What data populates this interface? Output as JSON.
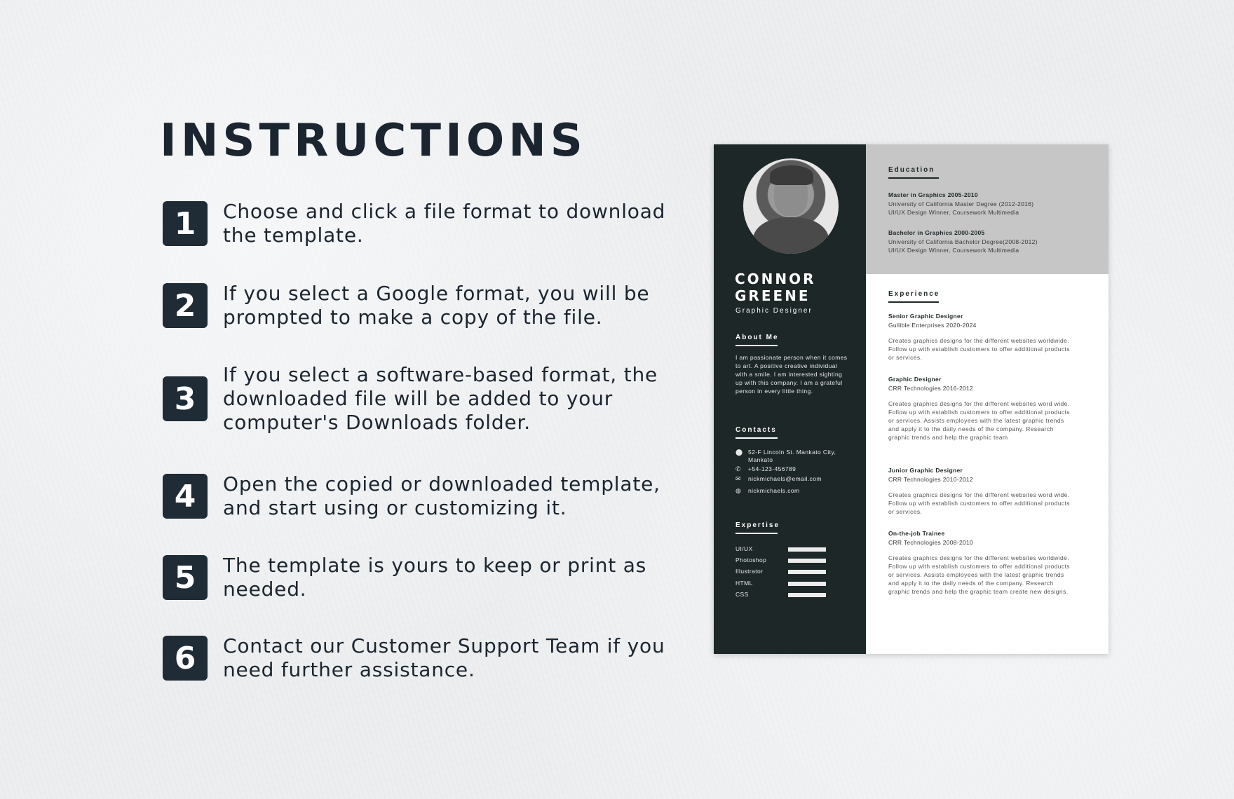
{
  "title": "INSTRUCTIONS",
  "steps": [
    {
      "num": "1",
      "text": "Choose and click a file format to download the template."
    },
    {
      "num": "2",
      "text": "If you select a Google format, you will be prompted to make a copy of the file."
    },
    {
      "num": "3",
      "text": "If you select a software-based format, the downloaded file will be added to your computer's Downloads folder."
    },
    {
      "num": "4",
      "text": "Open the copied or downloaded template, and start using or customizing it."
    },
    {
      "num": "5",
      "text": "The template is yours to keep or print as needed."
    },
    {
      "num": "6",
      "text": "Contact our Customer Support Team if you need further assistance."
    }
  ],
  "resume": {
    "name_line1": "CONNOR",
    "name_line2": "GREENE",
    "role": "Graphic Designer",
    "about_heading": "About Me",
    "about_text": "I am passionate person when it comes to art. A positive creative individual with a smile. I am interested sighting up with this company. I am a grateful person in every little thing.",
    "contacts_heading": "Contacts",
    "contacts": [
      {
        "icon": "location-icon",
        "glyph": "⬤",
        "text": "52-F Lincoln St. Mankato City, Mankato"
      },
      {
        "icon": "phone-icon",
        "glyph": "✆",
        "text": "+54-123-456789"
      },
      {
        "icon": "mail-icon",
        "glyph": "✉",
        "text": "nickmichaels@email.com"
      },
      {
        "icon": "globe-icon",
        "glyph": "◍",
        "text": "nickmichaels.com"
      }
    ],
    "expertise_heading": "Expertise",
    "skills": [
      "UI/UX",
      "Photoshop",
      "Illustrator",
      "HTML",
      "CSS"
    ],
    "education_heading": "Education",
    "education": [
      {
        "title": "Master in Graphics 2005-2010",
        "line1": "University of California Master Degree (2012-2016)",
        "line2": "UI/UX Design Winner, Coursework Multimedia"
      },
      {
        "title": "Bachelor in Graphics 2000-2005",
        "line1": "University of California Bachelor Degree(2008-2012)",
        "line2": "UI/UX Design Winner, Coursework Multimedia"
      }
    ],
    "experience_heading": "Experience",
    "experience": [
      {
        "title": "Senior Graphic Designer",
        "company": "Gullible Enterprises 2020-2024",
        "desc": "Creates graphics designs for the different websites worldwide. Follow up with establish customers to offer additional products or services."
      },
      {
        "title": "Graphic Designer",
        "company": "CRR Technologies 2016-2012",
        "desc": "Creates graphics designs for the different websites word wide. Follow up with establish customers to offer additional products or services. Assists employees with the latest graphic trends and apply it to the daily needs of the company. Research graphic trends and help the graphic team"
      },
      {
        "title": "Junior Graphic Designer",
        "company": "CRR Technologies 2010-2012",
        "desc": "Creates graphics designs for the different websites word wide. Follow up with establish customers to offer additional products or services."
      },
      {
        "title": "On-the-job Trainee",
        "company": "CRR Technologies 2008-2010",
        "desc": "Creates graphics designs for the different websites worldwide. Follow up with establish customers to offer additional products or services. Assists employees with the latest graphic trends and apply it to the daily needs of the company. Research graphic trends and help the graphic team create new designs."
      }
    ]
  }
}
